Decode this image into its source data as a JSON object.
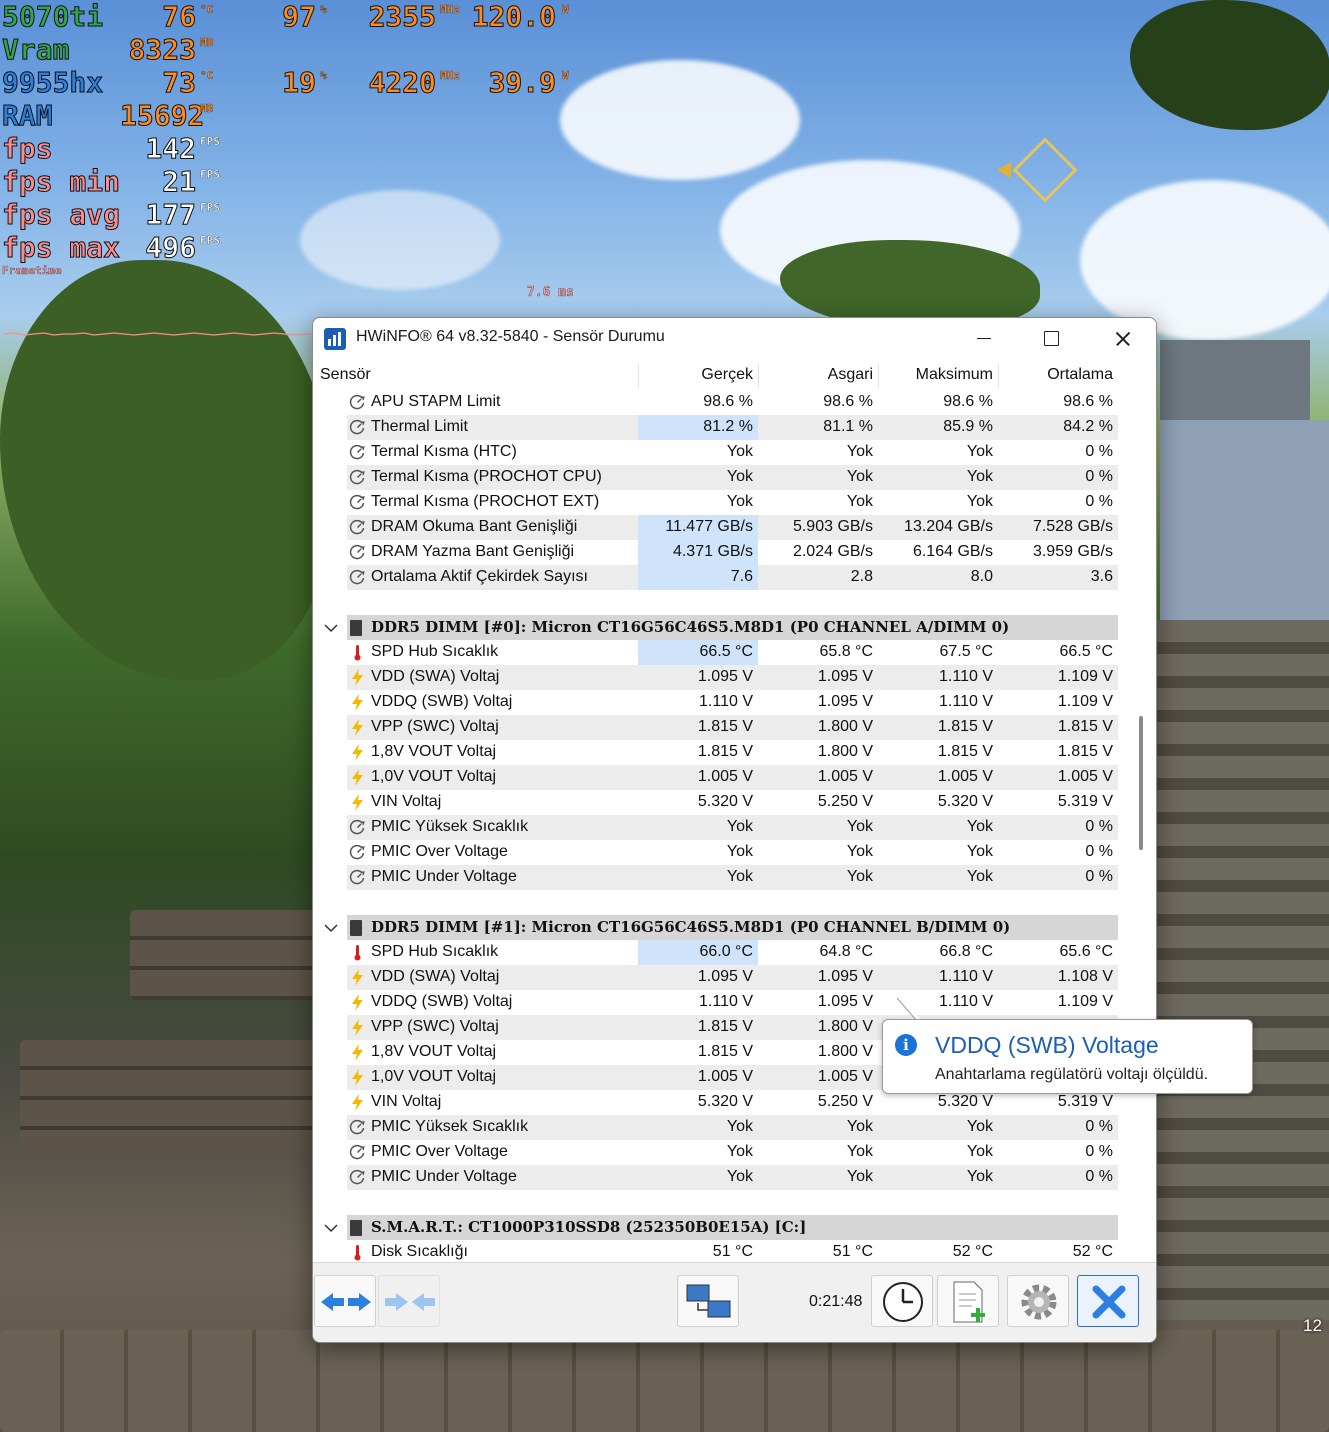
{
  "osd": {
    "rows": [
      {
        "label": "5070ti",
        "label_color": "#2ea84a",
        "v1": "76",
        "u1": "°C",
        "v2": "97",
        "u2": "%",
        "v3": "2355",
        "u3": "MHz",
        "v4": "120.0",
        "u4": "W"
      },
      {
        "label": "Vram",
        "label_color": "#2ea84a",
        "v1": "8323",
        "u1": "MB"
      },
      {
        "label": "9955hx",
        "label_color": "#2a7fe0",
        "v1": "73",
        "u1": "°C",
        "v2": "19",
        "u2": "%",
        "v3": "4220",
        "u3": "MHz",
        "v4": "39.9",
        "u4": "W"
      },
      {
        "label": "RAM",
        "label_color": "#2a7fe0",
        "v1": "15692",
        "u1": "MB"
      },
      {
        "label": "fps",
        "label_color": "#ff8a8a",
        "v1": "142",
        "u1": "FPS"
      },
      {
        "label": "fps min",
        "label_color": "#ff8a8a",
        "v1": "21",
        "u1": "FPS"
      },
      {
        "label": "fps avg",
        "label_color": "#ff8a8a",
        "v1": "177",
        "u1": "FPS"
      },
      {
        "label": "fps max",
        "label_color": "#ff8a8a",
        "v1": "496",
        "u1": "FPS"
      }
    ],
    "frametime_label": "Frametime",
    "frametime_value": "7.6 ms"
  },
  "window": {
    "title": "HWiNFO® 64 v8.32-5840 - Sensör Durumu",
    "columns": [
      "Sensör",
      "Gerçek",
      "Asgari",
      "Maksimum",
      "Ortalama"
    ],
    "top_rows": [
      {
        "icon": "clock",
        "name": "APU STAPM Limit",
        "v": [
          "98.6 %",
          "98.6 %",
          "98.6 %",
          "98.6 %"
        ],
        "hl": false
      },
      {
        "icon": "clock",
        "name": "Thermal Limit",
        "v": [
          "81.2 %",
          "81.1 %",
          "85.9 %",
          "84.2 %"
        ],
        "hl": true
      },
      {
        "icon": "clock",
        "name": "Termal Kısma (HTC)",
        "v": [
          "Yok",
          "Yok",
          "Yok",
          "0 %"
        ],
        "hl": false
      },
      {
        "icon": "clock",
        "name": "Termal Kısma (PROCHOT CPU)",
        "v": [
          "Yok",
          "Yok",
          "Yok",
          "0 %"
        ],
        "hl": false
      },
      {
        "icon": "clock",
        "name": "Termal Kısma (PROCHOT EXT)",
        "v": [
          "Yok",
          "Yok",
          "Yok",
          "0 %"
        ],
        "hl": false
      },
      {
        "icon": "clock",
        "name": "DRAM Okuma Bant Genişliği",
        "v": [
          "11.477 GB/s",
          "5.903 GB/s",
          "13.204 GB/s",
          "7.528 GB/s"
        ],
        "hl": true
      },
      {
        "icon": "clock",
        "name": "DRAM Yazma Bant Genişliği",
        "v": [
          "4.371 GB/s",
          "2.024 GB/s",
          "6.164 GB/s",
          "3.959 GB/s"
        ],
        "hl": true
      },
      {
        "icon": "clock",
        "name": "Ortalama Aktif Çekirdek Sayısı",
        "v": [
          "7.6",
          "2.8",
          "8.0",
          "3.6"
        ],
        "hl": true
      }
    ],
    "groups": [
      {
        "title": "DDR5 DIMM [#0]: Micron CT16G56C46S5.M8D1 (P0 CHANNEL A/DIMM 0)",
        "rows": [
          {
            "icon": "thermo",
            "name": "SPD Hub Sıcaklık",
            "v": [
              "66.5 °C",
              "65.8 °C",
              "67.5 °C",
              "66.5 °C"
            ],
            "hl": true
          },
          {
            "icon": "bolt",
            "name": "VDD (SWA) Voltaj",
            "v": [
              "1.095 V",
              "1.095 V",
              "1.110 V",
              "1.109 V"
            ],
            "hl": false
          },
          {
            "icon": "bolt",
            "name": "VDDQ (SWB) Voltaj",
            "v": [
              "1.110 V",
              "1.095 V",
              "1.110 V",
              "1.109 V"
            ],
            "hl": false
          },
          {
            "icon": "bolt",
            "name": "VPP (SWC) Voltaj",
            "v": [
              "1.815 V",
              "1.800 V",
              "1.815 V",
              "1.815 V"
            ],
            "hl": false
          },
          {
            "icon": "bolt",
            "name": "1,8V VOUT Voltaj",
            "v": [
              "1.815 V",
              "1.800 V",
              "1.815 V",
              "1.815 V"
            ],
            "hl": false
          },
          {
            "icon": "bolt",
            "name": "1,0V VOUT Voltaj",
            "v": [
              "1.005 V",
              "1.005 V",
              "1.005 V",
              "1.005 V"
            ],
            "hl": false
          },
          {
            "icon": "bolt",
            "name": "VIN Voltaj",
            "v": [
              "5.320 V",
              "5.250 V",
              "5.320 V",
              "5.319 V"
            ],
            "hl": false
          },
          {
            "icon": "clock",
            "name": "PMIC Yüksek Sıcaklık",
            "v": [
              "Yok",
              "Yok",
              "Yok",
              "0 %"
            ],
            "hl": false
          },
          {
            "icon": "clock",
            "name": "PMIC Over Voltage",
            "v": [
              "Yok",
              "Yok",
              "Yok",
              "0 %"
            ],
            "hl": false
          },
          {
            "icon": "clock",
            "name": "PMIC Under Voltage",
            "v": [
              "Yok",
              "Yok",
              "Yok",
              "0 %"
            ],
            "hl": false
          }
        ]
      },
      {
        "title": "DDR5 DIMM [#1]: Micron CT16G56C46S5.M8D1 (P0 CHANNEL B/DIMM 0)",
        "rows": [
          {
            "icon": "thermo",
            "name": "SPD Hub Sıcaklık",
            "v": [
              "66.0 °C",
              "64.8 °C",
              "66.8 °C",
              "65.6 °C"
            ],
            "hl": true
          },
          {
            "icon": "bolt",
            "name": "VDD (SWA) Voltaj",
            "v": [
              "1.095 V",
              "1.095 V",
              "1.110 V",
              "1.108 V"
            ],
            "hl": false
          },
          {
            "icon": "bolt",
            "name": "VDDQ (SWB) Voltaj",
            "v": [
              "1.110 V",
              "1.095 V",
              "1.110 V",
              "1.109 V"
            ],
            "hl": false
          },
          {
            "icon": "bolt",
            "name": "VPP (SWC) Voltaj",
            "v": [
              "1.815 V",
              "1.800 V",
              "",
              ""
            ],
            "hl": false
          },
          {
            "icon": "bolt",
            "name": "1,8V VOUT Voltaj",
            "v": [
              "1.815 V",
              "1.800 V",
              "",
              ""
            ],
            "hl": false
          },
          {
            "icon": "bolt",
            "name": "1,0V VOUT Voltaj",
            "v": [
              "1.005 V",
              "1.005 V",
              "",
              ""
            ],
            "hl": false
          },
          {
            "icon": "bolt",
            "name": "VIN Voltaj",
            "v": [
              "5.320 V",
              "5.250 V",
              "5.320 V",
              "5.319 V"
            ],
            "hl": false
          },
          {
            "icon": "clock",
            "name": "PMIC Yüksek Sıcaklık",
            "v": [
              "Yok",
              "Yok",
              "Yok",
              "0 %"
            ],
            "hl": false
          },
          {
            "icon": "clock",
            "name": "PMIC Over Voltage",
            "v": [
              "Yok",
              "Yok",
              "Yok",
              "0 %"
            ],
            "hl": false
          },
          {
            "icon": "clock",
            "name": "PMIC Under Voltage",
            "v": [
              "Yok",
              "Yok",
              "Yok",
              "0 %"
            ],
            "hl": false
          }
        ]
      },
      {
        "title": "S.M.A.R.T.: CT1000P310SSD8 (252350B0E15A) [C:]",
        "rows": [
          {
            "icon": "thermo",
            "name": "Disk Sıcaklığı",
            "v": [
              "51 °C",
              "51 °C",
              "52 °C",
              "52 °C"
            ],
            "hl": false
          }
        ]
      }
    ],
    "timer": "0:21:48",
    "toolbar_icons": [
      "arrows-both-icon",
      "arrows-collapse-icon",
      "network-icon",
      "clock-icon",
      "add-report-icon",
      "settings-gear-icon",
      "close-x-icon"
    ]
  },
  "tooltip": {
    "title": "VDDQ (SWB) Voltage",
    "body": "Anahtarlama regülatörü voltajı ölçüldü."
  },
  "hud": {
    "corner_number": "12"
  },
  "colors": {
    "highlight": "#cfe4fb",
    "group_band": "#d6d6d6",
    "accent": "#1a5fb4",
    "bolt": "#f5b800",
    "thermo": "#d42020"
  }
}
